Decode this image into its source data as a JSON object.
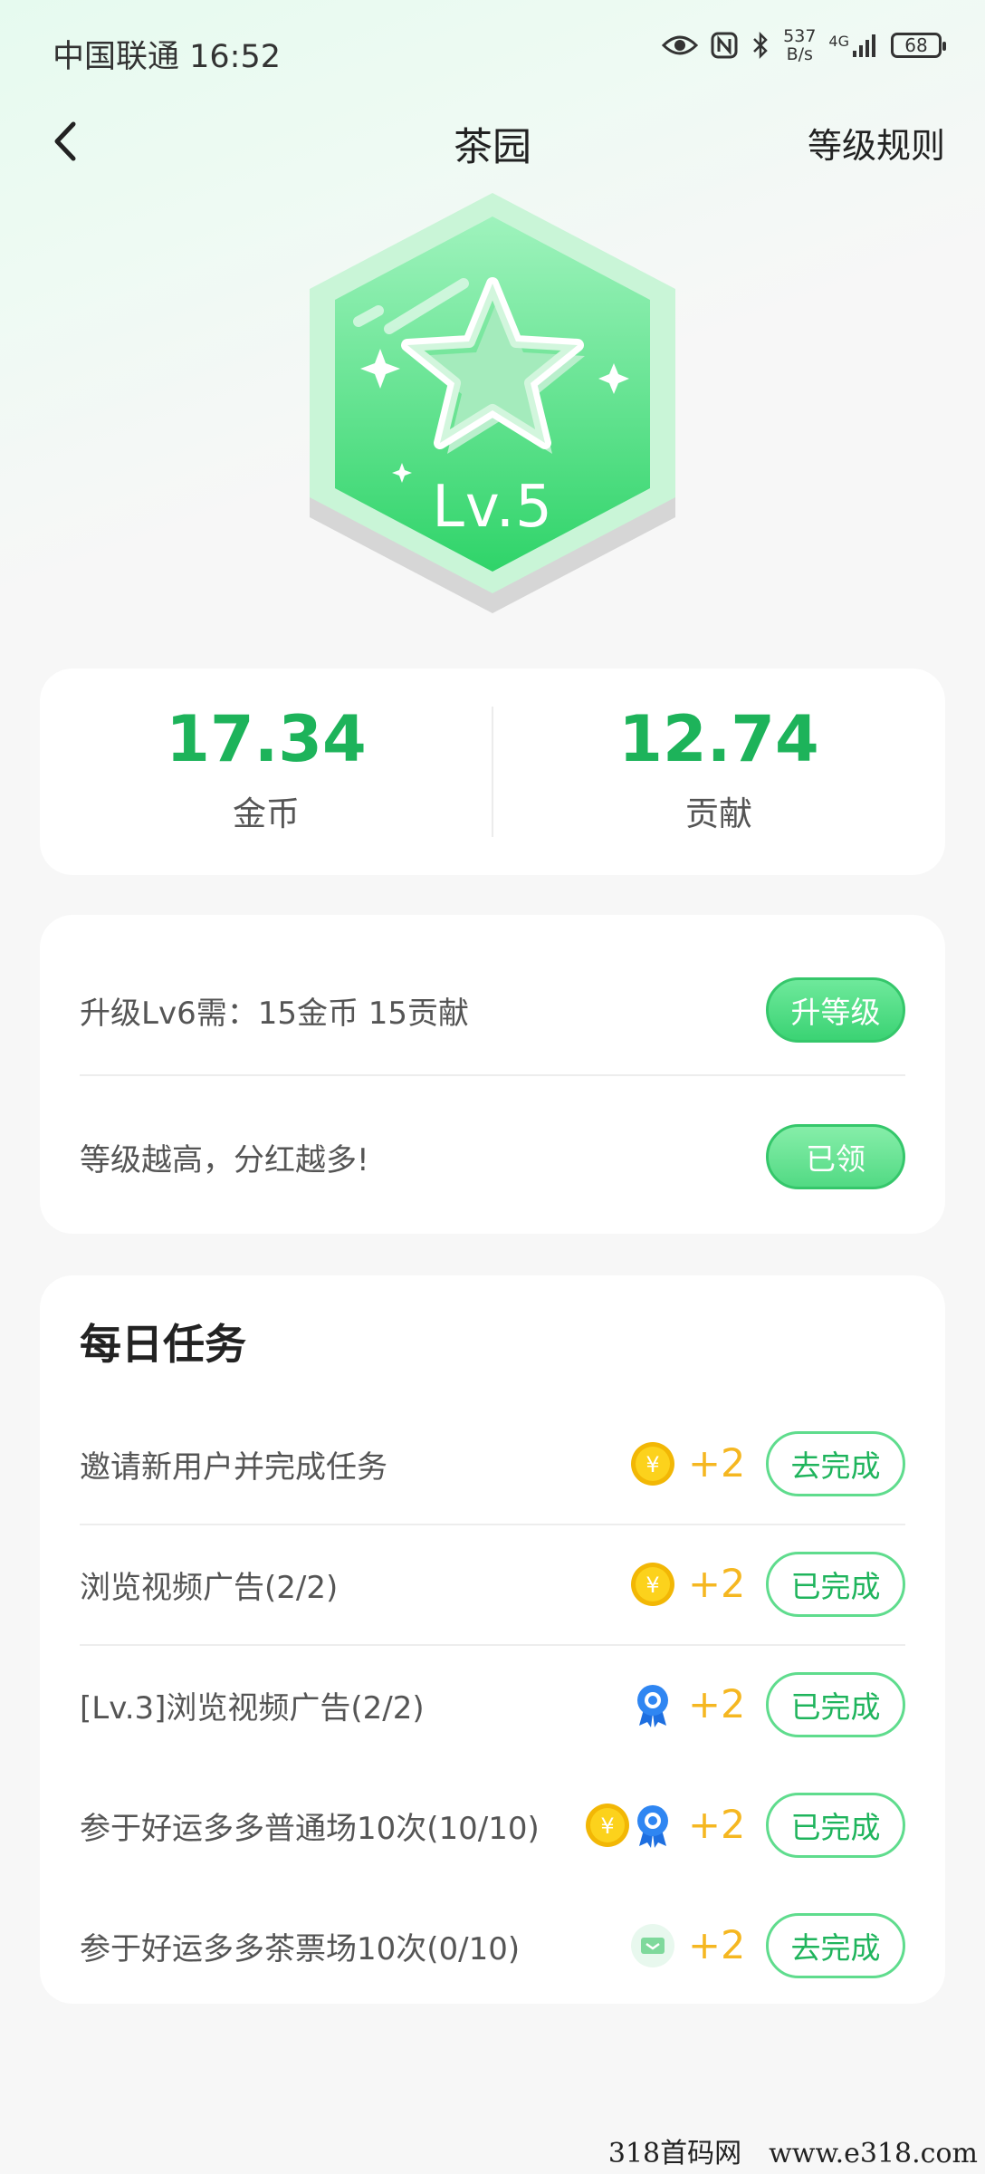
{
  "status_bar": {
    "carrier_time": "中国联通 16:52",
    "net_speed_value": "537",
    "net_speed_unit": "B/s",
    "network_type": "4G",
    "battery": "68"
  },
  "nav": {
    "title": "茶园",
    "rules": "等级规则"
  },
  "badge": {
    "level": "Lv.5"
  },
  "stats": {
    "coins_value": "17.34",
    "coins_label": "金币",
    "contribution_value": "12.74",
    "contribution_label": "贡献"
  },
  "upgrade": {
    "requirement_text": "升级Lv6需：15金币 15贡献",
    "upgrade_button": "升等级",
    "bonus_text": "等级越高，分红越多!",
    "claimed_button": "已领"
  },
  "tasks": {
    "title": "每日任务",
    "items": [
      {
        "name": "邀请新用户并完成任务",
        "reward": "+2",
        "icons": [
          "coin-icon"
        ],
        "button": "去完成"
      },
      {
        "name": "浏览视频广告(2/2)",
        "reward": "+2",
        "icons": [
          "coin-icon"
        ],
        "button": "已完成"
      },
      {
        "name": "[Lv.3]浏览视频广告(2/2)",
        "reward": "+2",
        "icons": [
          "medal-icon"
        ],
        "button": "已完成"
      },
      {
        "name": "参于好运多多普通场10次(10/10)",
        "reward": "+2",
        "icons": [
          "coin-icon",
          "medal-icon"
        ],
        "button": "已完成"
      },
      {
        "name": "参于好运多多茶票场10次(0/10)",
        "reward": "+2",
        "icons": [
          "ticket-icon"
        ],
        "button": "去完成"
      }
    ]
  },
  "watermark": "318首码网　www.e318.com",
  "colors": {
    "accent_green": "#1db35a",
    "button_green": "#3bd374",
    "reward_gold": "#f5b721"
  }
}
